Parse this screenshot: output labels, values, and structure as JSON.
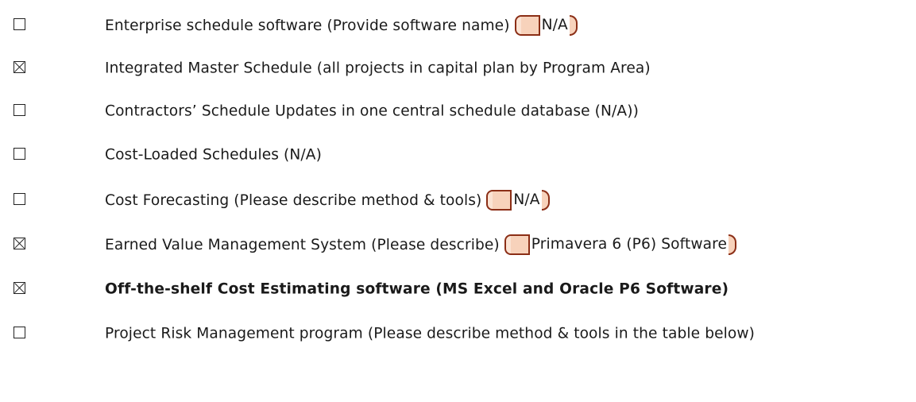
{
  "items": [
    {
      "checked": false,
      "label": "Enterprise schedule software (Provide software name)",
      "field": "N/A",
      "bold": false
    },
    {
      "checked": true,
      "label": "Integrated Master Schedule (all projects in capital plan by Program Area)",
      "field": null,
      "bold": false
    },
    {
      "checked": false,
      "label": "Contractors’ Schedule Updates in one central schedule database (N/A))",
      "field": null,
      "bold": false
    },
    {
      "checked": false,
      "label": "Cost-Loaded Schedules (N/A)",
      "field": null,
      "bold": false
    },
    {
      "checked": false,
      "label": "Cost Forecasting (Please describe method & tools)",
      "field": "N/A",
      "bold": false
    },
    {
      "checked": true,
      "label": "Earned Value Management System (Please describe)",
      "field": "Primavera 6 (P6) Software",
      "bold": false
    },
    {
      "checked": true,
      "label": "Off-the-shelf Cost Estimating software (MS Excel and Oracle P6 Software)",
      "field": null,
      "bold": true
    },
    {
      "checked": false,
      "label": "Project Risk Management program (Please describe method & tools in the table below)",
      "field": null,
      "bold": false
    }
  ]
}
